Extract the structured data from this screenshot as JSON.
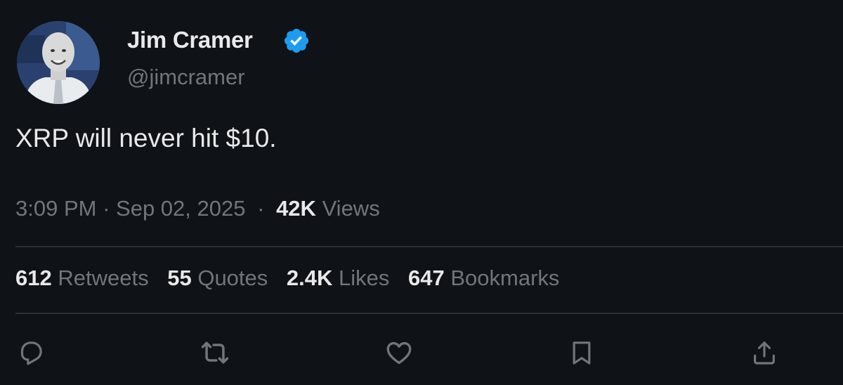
{
  "author": {
    "display_name": "Jim Cramer",
    "handle": "@jimcramer",
    "verified": true,
    "avatar": "avatar-photo"
  },
  "tweet": {
    "text": "XRP will never hit $10.",
    "time": "3:09 PM",
    "separator": "·",
    "date": "Sep 02, 2025",
    "views_count": "42K",
    "views_label": "Views"
  },
  "stats": {
    "retweets_count": "612",
    "retweets_label": "Retweets",
    "quotes_count": "55",
    "quotes_label": "Quotes",
    "likes_count": "2.4K",
    "likes_label": "Likes",
    "bookmarks_count": "647",
    "bookmarks_label": "Bookmarks"
  },
  "actions": [
    "reply-icon",
    "retweet-icon",
    "like-icon",
    "bookmark-icon",
    "share-icon"
  ],
  "colors": {
    "background": "#0f1216",
    "text_primary": "#e7e9ea",
    "text_secondary": "#71767b",
    "verified_blue": "#1d9bf0",
    "divider": "#2b2f34"
  }
}
